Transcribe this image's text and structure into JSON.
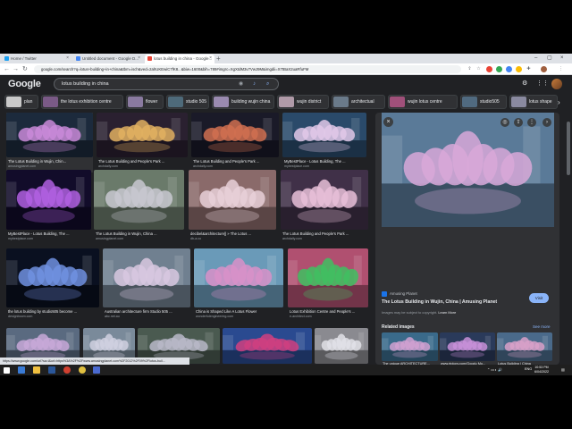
{
  "browser": {
    "tabs": [
      {
        "label": "Home / Twitter",
        "active": false,
        "color": "#1da1f2"
      },
      {
        "label": "Untitled document - Google D...",
        "active": false,
        "color": "#4285f4"
      },
      {
        "label": "lotus building in china - Google...",
        "active": true,
        "color": "#ea4335"
      }
    ],
    "new_tab": "+",
    "url": "google.com/search?q=lotus+building+in+china&tbm=isch&ved=2ahUKEwiC7fK8...&biw=1600&bih=789#imgrc=XgXtdM3v7VwJ9M&imgdii=X7tBaX2uaRfuFM"
  },
  "google": {
    "logo": "Google",
    "query": "lotus building in china"
  },
  "chips": [
    {
      "label": "plan",
      "thumb": "#c9c9c9"
    },
    {
      "label": "the lotus exhibition centre",
      "thumb": "#7a5a86"
    },
    {
      "label": "flower",
      "thumb": "#8a7aa0"
    },
    {
      "label": "studio 505",
      "thumb": "#4e6a7a"
    },
    {
      "label": "building wujin china",
      "thumb": "#9a8ab0"
    },
    {
      "label": "wujin district",
      "thumb": "#b09aa8"
    },
    {
      "label": "architectual",
      "thumb": "#6a7a8a"
    },
    {
      "label": "wujin lotus centre",
      "thumb": "#a0507a"
    },
    {
      "label": "studio505",
      "thumb": "#506a80"
    },
    {
      "label": "lotus shape",
      "thumb": "#8a8aa0"
    }
  ],
  "results": [
    {
      "caption": "The Lotus Building in Wujin, Chin...",
      "source": "amusingplanet.com",
      "bg": "#1c2a3c",
      "lotus": "#c98ad8",
      "selected": true
    },
    {
      "caption": "The Lotus Building and People's Park ...",
      "source": "archdaily.com",
      "bg": "#2a2030",
      "lotus": "#e0b060"
    },
    {
      "caption": "The Lotus Building and People's Park ...",
      "source": "archdaily.com",
      "bg": "#1a1a28",
      "lotus": "#d07050"
    },
    {
      "caption": "MyBestPlace - Lotus Building, The ...",
      "source": "mybestplace.com",
      "bg": "#2a4a6a",
      "lotus": "#e0c8e8"
    },
    {
      "caption": "MyBestPlace - Lotus Building, The ...",
      "source": "mybestplace.com",
      "bg": "#120c2a",
      "lotus": "#b060e0"
    },
    {
      "caption": "The Lotus Building in Wujin, China ...",
      "source": "amusingplanet.com",
      "bg": "#6a7a6a",
      "lotus": "#c8c8d0"
    },
    {
      "caption": "decibel&architecture|| » The Lotus ...",
      "source": "db-a.co",
      "bg": "#8a6a6a",
      "lotus": "#e8d0d8"
    },
    {
      "caption": "The Lotus Building and People's Park ...",
      "source": "archdaily.com",
      "bg": "#403048",
      "lotus": "#e8c0d8"
    },
    {
      "caption": "the lotus building by studio505 become ...",
      "source": "designboom.com",
      "bg": "#0a1020",
      "lotus": "#7090e0"
    },
    {
      "caption": "Australian architecture firm Studio 505 ...",
      "source": "abc.net.au",
      "bg": "#708090",
      "lotus": "#d8c8e0"
    },
    {
      "caption": "China is Shaped Like A Lotus Flower",
      "source": "wonderfulengineering.com",
      "bg": "#6a9ab8",
      "lotus": "#d890c8"
    },
    {
      "caption": "Lotus Exhibition Centre and People's ...",
      "source": "e-architect.com",
      "bg": "#b05070",
      "lotus": "#40c060"
    },
    {
      "caption": "",
      "source": "",
      "bg": "#5a6a80",
      "lotus": "#c8a8d8"
    },
    {
      "caption": "",
      "source": "",
      "bg": "#7a8a9a",
      "lotus": "#d0d0e0"
    },
    {
      "caption": "",
      "source": "",
      "bg": "#4a5a50",
      "lotus": "#b8b8c8"
    },
    {
      "caption": "",
      "source": "",
      "bg": "#2a4a90",
      "lotus": "#d04080"
    },
    {
      "caption": "",
      "source": "",
      "bg": "#8a8a90",
      "lotus": "#e0e0e8"
    }
  ],
  "panel": {
    "source_name": "Amusing Planet",
    "title": "The Lotus Building in Wujin, China | Amusing Planet",
    "copyright_prefix": "Images may be subject to copyright.",
    "learn_more": "Learn More",
    "visit": "Visit",
    "related_heading": "Related images",
    "see_more": "See more",
    "related": [
      {
        "caption": "The unique ARCHITECTURE...",
        "source": "inspirationfeeds.com",
        "bg": "#3a6a8a",
        "lotus": "#d0a0d0"
      },
      {
        "caption": "www.rtplcpy.com/Goodu Mo...",
        "source": "rtplcpy.com",
        "bg": "#2a3a5a",
        "lotus": "#c890d8"
      },
      {
        "caption": "Lotus Building | China",
        "source": "",
        "bg": "#4a6a8a",
        "lotus": "#d8a0c8"
      },
      {
        "caption": "",
        "source": "",
        "bg": "#301c40",
        "lotus": "#c060d0"
      },
      {
        "caption": "",
        "source": "",
        "bg": "#2a1a3a",
        "lotus": "#e070c0"
      },
      {
        "caption": "",
        "source": "",
        "bg": "#3a3050",
        "lotus": "#e0a050"
      }
    ]
  },
  "status_url": "https://www.google.com/url?sa=i&url=https%3A%2F%2Fwww.amusingplanet.com%2F2012%2F09%2Flotus-buil...",
  "taskbar": {
    "language": "ENG",
    "time": "10:53 PM",
    "date": "6/04/2022"
  }
}
